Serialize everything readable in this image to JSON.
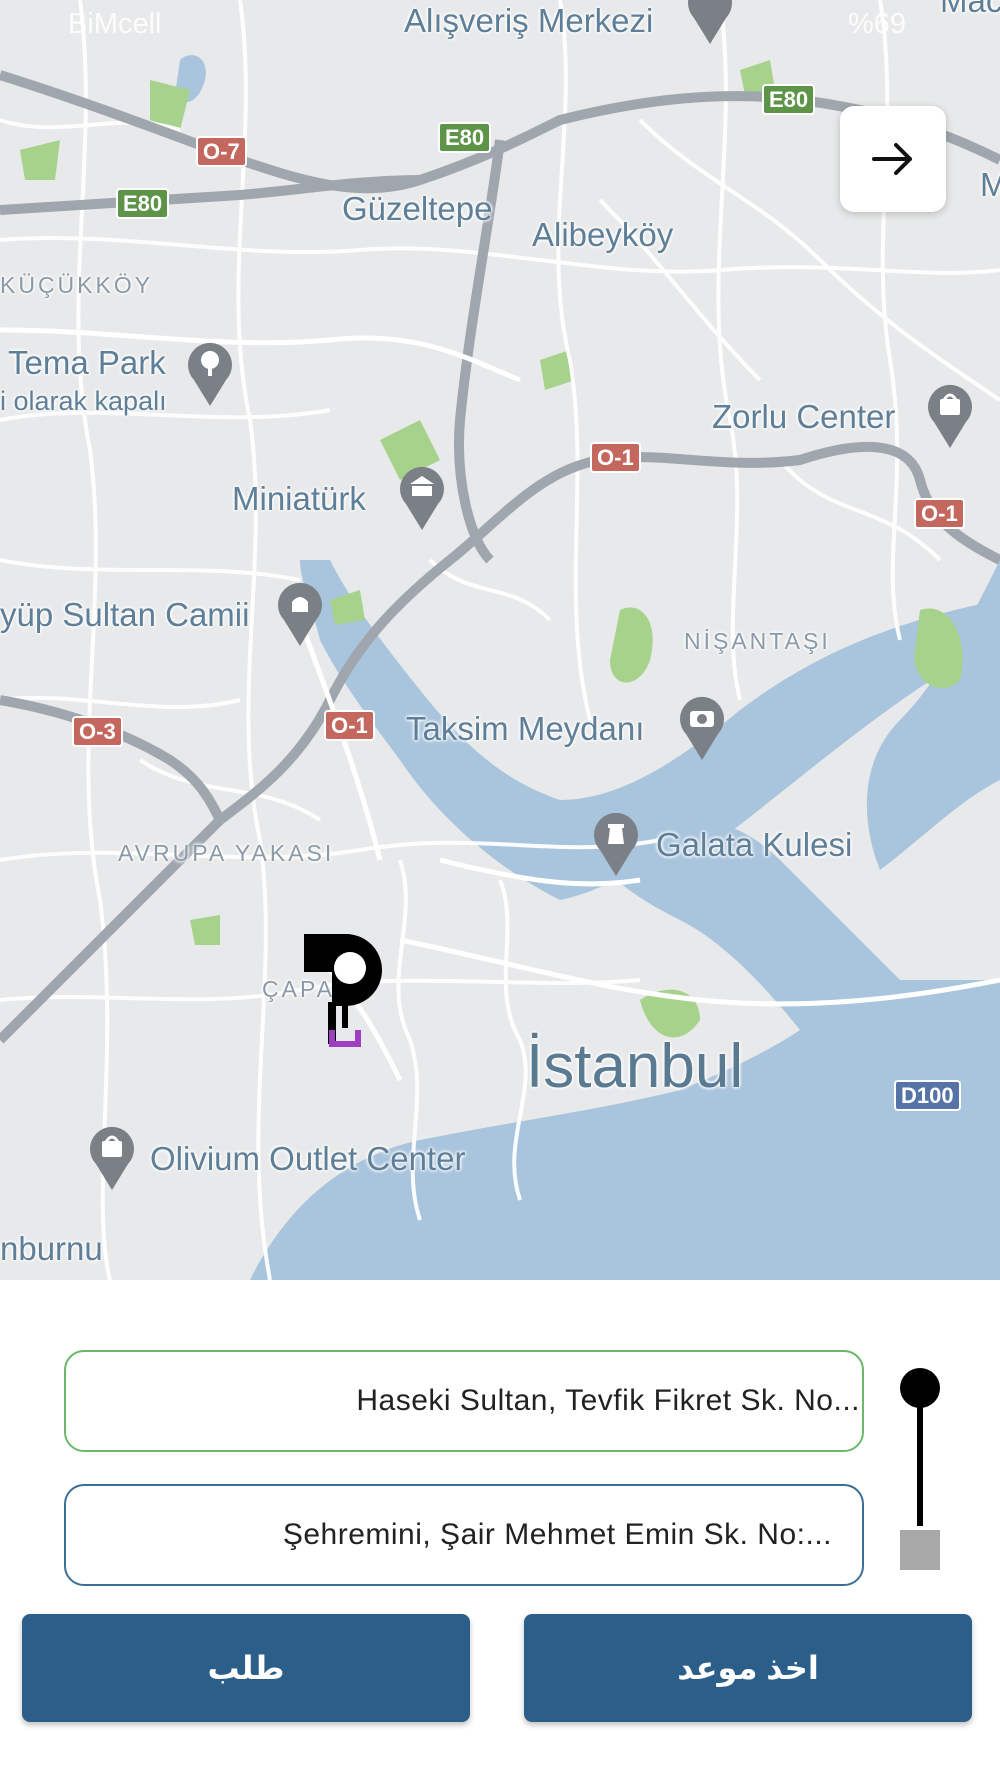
{
  "status_bar": {
    "carrier": "BiMcell",
    "battery": "%69"
  },
  "map": {
    "labels": {
      "alisveris": "Alışveriş Merkezi",
      "guzeltepe": "Güzeltepe",
      "alibeykoy": "Alibeyköy",
      "kucukkoy": "KÜÇÜKKÖY",
      "tema_park": "Tema Park",
      "tema_sub": "i olarak kapalı",
      "zorlu": "Zorlu Center",
      "miniaturk": "Miniatürk",
      "eyup": "yüp Sultan Camii",
      "nisantasi": "NİŞANTAŞI",
      "taksim": "Taksim Meydanı",
      "avrupa": "AVRUPA YAKASI",
      "galata": "Galata Kulesi",
      "capa": "ÇAPA",
      "istanbul": "İstanbul",
      "olivium": "Olivium Outlet Center",
      "burnu": "nburnu",
      "top_right": "Mac"
    },
    "shields": {
      "o7": "O-7",
      "e80a": "E80",
      "e80b": "E80",
      "e80c": "E80",
      "o1a": "O-1",
      "o1b": "O-1",
      "o1c": "O-1",
      "o3": "O-3",
      "d100": "D100",
      "m": "M"
    },
    "icons": {
      "forward": "arrow-right-icon",
      "shopping": "shopping-bag-icon",
      "museum": "museum-icon",
      "mosque": "mosque-icon",
      "camera": "camera-icon",
      "tower": "tower-icon",
      "park": "tree-icon"
    }
  },
  "form": {
    "origin": "Haseki Sultan, Tevfik Fikret Sk. No...",
    "destination": "Şehremini, Şair Mehmet Emin Sk. No:..."
  },
  "buttons": {
    "order": "طلب",
    "book": "اخذ موعد"
  },
  "colors": {
    "primary": "#2b5f89",
    "origin_border": "#6bb86b",
    "destination_border": "#3b6f93"
  }
}
